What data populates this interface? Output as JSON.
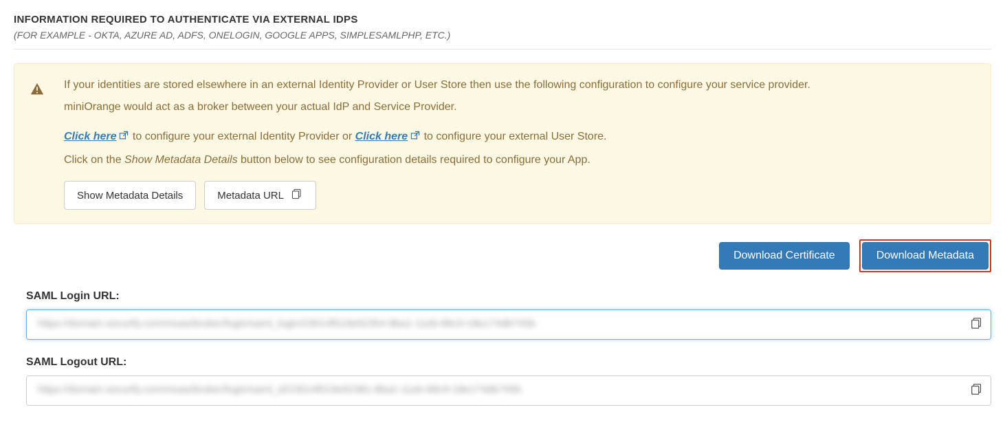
{
  "section": {
    "title": "INFORMATION REQUIRED TO AUTHENTICATE VIA EXTERNAL IDPS",
    "subtitle": "(FOR EXAMPLE - OKTA, AZURE AD, ADFS, ONELOGIN, GOOGLE APPS, SIMPLESAMLPHP, ETC.)"
  },
  "alert": {
    "line1": "If your identities are stored elsewhere in an external Identity Provider or User Store then use the following configuration to configure your service provider.",
    "line2": "miniOrange would act as a broker between your actual IdP and Service Provider.",
    "click_here_1": "Click here",
    "config_idp_text": " to configure your external Identity Provider or ",
    "click_here_2": "Click here",
    "config_userstore_text": " to configure your external User Store.",
    "line4_pre": "Click on the ",
    "line4_italic": "Show Metadata Details",
    "line4_post": " button below to see configuration details required to configure your App.",
    "btn_show_metadata": "Show Metadata Details",
    "btn_metadata_url": "Metadata URL"
  },
  "buttons": {
    "download_certificate": "Download Certificate",
    "download_metadata": "Download Metadata"
  },
  "fields": {
    "login_label": "SAML Login URL:",
    "login_value": "https://domain.xecurify.com/moas/broker/login/saml_login/23014f019e92354-8ba1-11eb-89c9-18e174db745b",
    "logout_label": "SAML Logout URL:",
    "logout_value": "https://domain.xecurify.com/moas/broker/login/saml_sl/23014f019e92381-8ba1-11eb-89c9-18e174db745b"
  }
}
